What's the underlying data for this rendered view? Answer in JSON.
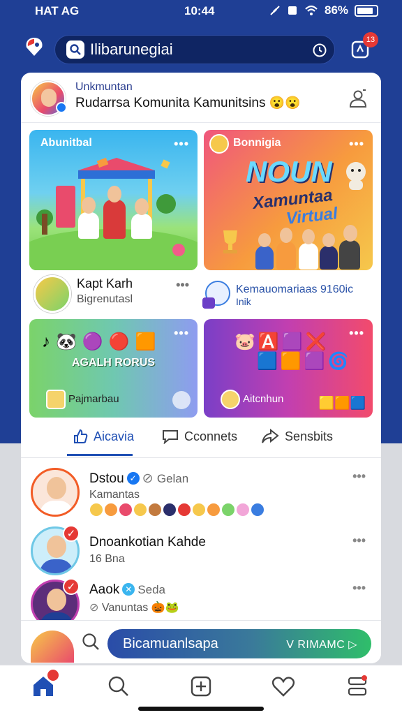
{
  "status_bar": {
    "carrier": "HAT AG",
    "time": "10:44",
    "battery": "86%"
  },
  "app_bar": {
    "search_text": "Ilibarunegiai",
    "notification_count": "13"
  },
  "group": {
    "subtitle": "Unkmuntan",
    "title": "Rudarrsa Komunita Kamunitsins",
    "title_emojis": "😮😮"
  },
  "tiles": [
    {
      "title": "Abunitbal",
      "author_name": "Kapt Karh",
      "author_sub": "Bigrenutasl"
    },
    {
      "title": "Bonnigia",
      "poster_big": "NOUN",
      "poster_line1": "Xamuntaa",
      "poster_line2": "Virtual",
      "meta_name": "Kemauomariaas 9160ic",
      "meta_sub": "Inik"
    },
    {
      "center_text": "AGALH RORUS",
      "footer": "Pajmarbau"
    },
    {
      "footer": "Aitcnhun"
    }
  ],
  "actions": [
    {
      "label": "Aicavia",
      "icon": "thumbs-up-icon",
      "active": true
    },
    {
      "label": "Cconnets",
      "icon": "comment-icon",
      "active": false
    },
    {
      "label": "Sensbits",
      "icon": "share-icon",
      "active": false
    }
  ],
  "comments": [
    {
      "name": "Dstou",
      "tag": "Gelan",
      "sub": "Kamantas",
      "has_reactions": true
    },
    {
      "name": "Dnoankotian Kahde",
      "sub": "16 Bna"
    },
    {
      "name": "Aaok",
      "tag": "Seda",
      "sub": "Vanuntas"
    }
  ],
  "composer": {
    "label": "Bicamuanlsapa",
    "cta": "V RIMAMC ▷"
  },
  "colors": {
    "brand_blue": "#1f3f95",
    "accent_red": "#e53935",
    "link_blue": "#1f4fb4"
  }
}
